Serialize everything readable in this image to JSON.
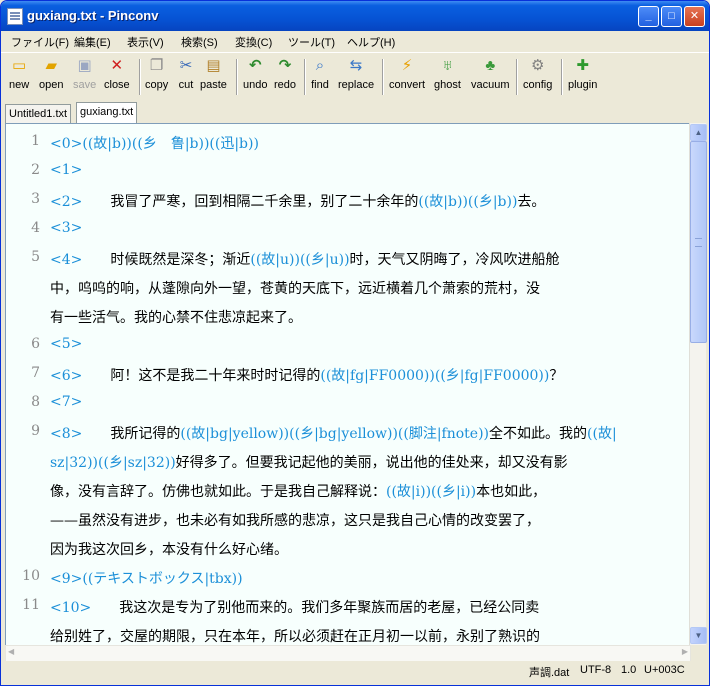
{
  "window": {
    "title": "guxiang.txt - Pinconv",
    "minimize": "_",
    "maximize": "□",
    "close": "✕"
  },
  "menu": [
    "ファイル(F)",
    "編集(E)",
    "表示(V)",
    "検索(S)",
    "変換(C)",
    "ツール(T)",
    "ヘルプ(H)"
  ],
  "toolbar": {
    "new": "new",
    "open": "open",
    "save": "save",
    "close": "close",
    "copy": "copy",
    "cut": "cut",
    "paste": "paste",
    "undo": "undo",
    "redo": "redo",
    "find": "find",
    "replace": "replace",
    "convert": "convert",
    "ghost": "ghost",
    "vacuum": "vacuum",
    "config": "config",
    "plugin": "plugin"
  },
  "tabs": [
    "Untitled1.txt",
    "guxiang.txt"
  ],
  "editor": {
    "line_numbers": [
      "1",
      "2",
      "3",
      "4",
      "5",
      "6",
      "7",
      "8",
      "9",
      "10",
      "11"
    ],
    "rows": [
      {
        "n": "1",
        "parts": [
          {
            "t": "<0>((故|b))((乡　鲁|b))((迅|b))",
            "tag": true
          }
        ]
      },
      {
        "n": "2",
        "parts": [
          {
            "t": "<1>",
            "tag": true
          }
        ]
      },
      {
        "n": "3",
        "parts": [
          {
            "t": "<2>",
            "tag": true
          },
          {
            "t": "　　我冒了严寒，回到相隔二千余里，别了二十余年的",
            "tag": false
          },
          {
            "t": "((故|b))((乡|b))",
            "tag": true
          },
          {
            "t": "去。",
            "tag": false
          }
        ]
      },
      {
        "n": "4",
        "parts": [
          {
            "t": "<3>",
            "tag": true
          }
        ]
      },
      {
        "n": "5",
        "parts": [
          {
            "t": "<4>",
            "tag": true
          },
          {
            "t": "　　时候既然是深冬；渐近",
            "tag": false
          },
          {
            "t": "((故|u))((乡|u))",
            "tag": true
          },
          {
            "t": "时，天气又阴晦了，冷风吹进船舱",
            "tag": false
          }
        ]
      },
      {
        "n": "",
        "parts": [
          {
            "t": "中，呜呜的响，从蓬隙向外一望，苍黄的天底下，远近横着几个萧索的荒村，没",
            "tag": false
          }
        ]
      },
      {
        "n": "",
        "parts": [
          {
            "t": "有一些活气。我的心禁不住悲凉起来了。",
            "tag": false
          }
        ]
      },
      {
        "n": "6",
        "parts": [
          {
            "t": "<5>",
            "tag": true
          }
        ]
      },
      {
        "n": "7",
        "parts": [
          {
            "t": "<6>",
            "tag": true
          },
          {
            "t": "　　阿！这不是我二十年来时时记得的",
            "tag": false
          },
          {
            "t": "((故|fg|FF0000))((乡|fg|FF0000))",
            "tag": true
          },
          {
            "t": "？",
            "tag": false
          }
        ]
      },
      {
        "n": "8",
        "parts": [
          {
            "t": "<7>",
            "tag": true
          }
        ]
      },
      {
        "n": "9",
        "parts": [
          {
            "t": "<8>",
            "tag": true
          },
          {
            "t": "　　我所记得的",
            "tag": false
          },
          {
            "t": "((故|bg|yellow))((乡|bg|yellow))((脚注|fnote))",
            "tag": true
          },
          {
            "t": "全不如此。我的",
            "tag": false
          },
          {
            "t": "((故|",
            "tag": true
          }
        ]
      },
      {
        "n": "",
        "parts": [
          {
            "t": "sz|32))((乡|sz|32))",
            "tag": true
          },
          {
            "t": "好得多了。但要我记起他的美丽，说出他的佳处来，却又没有影",
            "tag": false
          }
        ]
      },
      {
        "n": "",
        "parts": [
          {
            "t": "像，没有言辞了。仿佛也就如此。于是我自己解释说：",
            "tag": false
          },
          {
            "t": "((故|i))((乡|i))",
            "tag": true
          },
          {
            "t": "本也如此，",
            "tag": false
          }
        ]
      },
      {
        "n": "",
        "parts": [
          {
            "t": "——虽然没有进步，也未必有如我所感的悲凉，这只是我自己心情的改变罢了，",
            "tag": false
          }
        ]
      },
      {
        "n": "",
        "parts": [
          {
            "t": "因为我这次回乡，本没有什么好心绪。",
            "tag": false
          }
        ]
      },
      {
        "n": "10",
        "parts": [
          {
            "t": "<9>((テキストボックス|tbx))",
            "tag": true
          }
        ]
      },
      {
        "n": "11",
        "parts": [
          {
            "t": "<10>",
            "tag": true
          },
          {
            "t": "　　我这次是专为了别他而来的。我们多年聚族而居的老屋，已经公同卖",
            "tag": false
          }
        ]
      },
      {
        "n": "",
        "parts": [
          {
            "t": "给别姓了，交屋的期限，只在本年，所以必须赶在正月初一以前，永别了熟识的",
            "tag": false
          }
        ]
      }
    ]
  },
  "statusbar": {
    "file": "声調.dat",
    "encoding": "UTF-8",
    "version": "1.0",
    "char": "U+003C"
  },
  "scroll": {
    "up": "▲",
    "down": "▼",
    "left": "◀",
    "right": "▶"
  }
}
